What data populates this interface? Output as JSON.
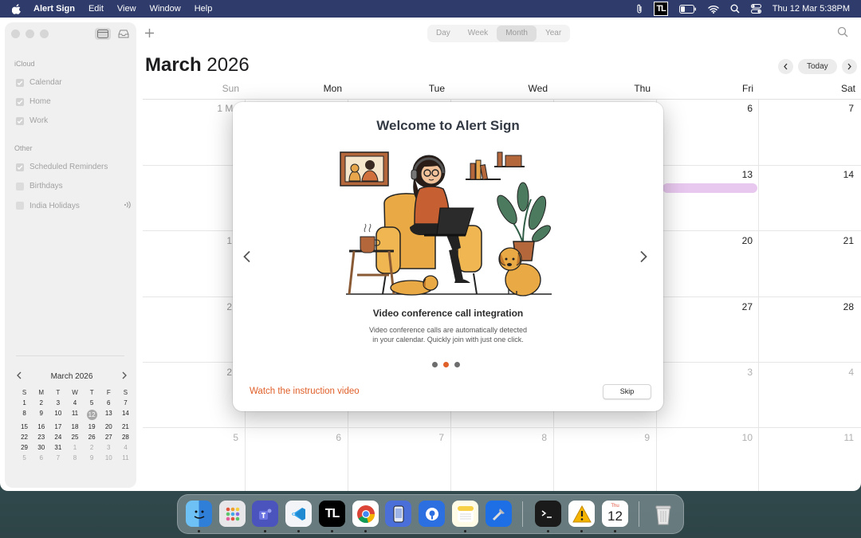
{
  "menubar": {
    "app_name": "Alert Sign",
    "menus": [
      "Edit",
      "View",
      "Window",
      "Help"
    ],
    "tray_badge": "TL",
    "clock": "Thu 12 Mar  5:38PM"
  },
  "toolbar": {
    "views": [
      "Day",
      "Week",
      "Month",
      "Year"
    ],
    "selected_view": "Month",
    "today_label": "Today"
  },
  "sidebar": {
    "icloud_label": "iCloud",
    "icloud_items": [
      {
        "label": "Calendar",
        "checked": true
      },
      {
        "label": "Home",
        "checked": true
      },
      {
        "label": "Work",
        "checked": true
      }
    ],
    "other_label": "Other",
    "other_items": [
      {
        "label": "Scheduled Reminders",
        "checked": true
      },
      {
        "label": "Birthdays",
        "checked": false
      },
      {
        "label": "India Holidays",
        "checked": false
      }
    ],
    "mini_calendar": {
      "title": "March 2026",
      "weekdays": [
        "S",
        "M",
        "T",
        "W",
        "T",
        "F",
        "S"
      ],
      "rows": [
        [
          "1",
          "2",
          "3",
          "4",
          "5",
          "6",
          "7"
        ],
        [
          "8",
          "9",
          "10",
          "11",
          "12",
          "13",
          "14"
        ],
        [
          "15",
          "16",
          "17",
          "18",
          "19",
          "20",
          "21"
        ],
        [
          "22",
          "23",
          "24",
          "25",
          "26",
          "27",
          "28"
        ],
        [
          "29",
          "30",
          "31",
          "1",
          "2",
          "3",
          "4"
        ],
        [
          "5",
          "6",
          "7",
          "8",
          "9",
          "10",
          "11"
        ]
      ],
      "today": "12"
    }
  },
  "calendar": {
    "month_bold": "March",
    "year": "2026",
    "weekdays": [
      "Sun",
      "Mon",
      "Tue",
      "Wed",
      "Thu",
      "Fri",
      "Sat"
    ],
    "visible_days": {
      "r0_sun": "1 Ma",
      "r0_fri": "6",
      "r0_sat": "7",
      "r1_fri": "13",
      "r1_sat": "14",
      "r2_sun": "1",
      "r2_fri": "20",
      "r2_sat": "21",
      "r3_sun": "2",
      "r3_fri": "27",
      "r3_sat": "28",
      "r4_sun": "2",
      "r4_fri": "3",
      "r4_sat": "4",
      "r5": [
        "5",
        "6",
        "7",
        "8",
        "9",
        "10",
        "11"
      ]
    }
  },
  "modal": {
    "title": "Welcome to Alert Sign",
    "feature_title": "Video conference call integration",
    "feature_desc_line1": "Video conference calls are automatically detected",
    "feature_desc_line2": "in your calendar. Quickly join with just one click.",
    "watch_link": "Watch the instruction video",
    "skip_label": "Skip",
    "page_count": 3,
    "active_page": 2,
    "accent_color": "#e0602a"
  },
  "dock": {
    "apps": [
      "Finder",
      "Launchpad",
      "Teams",
      "VS Code",
      "TL",
      "Chrome",
      "Simulator",
      "Proxyman",
      "Notes",
      "Xcode",
      "Terminal",
      "Alert Sign",
      "Calendar",
      "Trash"
    ],
    "calendar_icon_month": "Thu",
    "calendar_icon_day": "12",
    "tl_label": "TL"
  }
}
